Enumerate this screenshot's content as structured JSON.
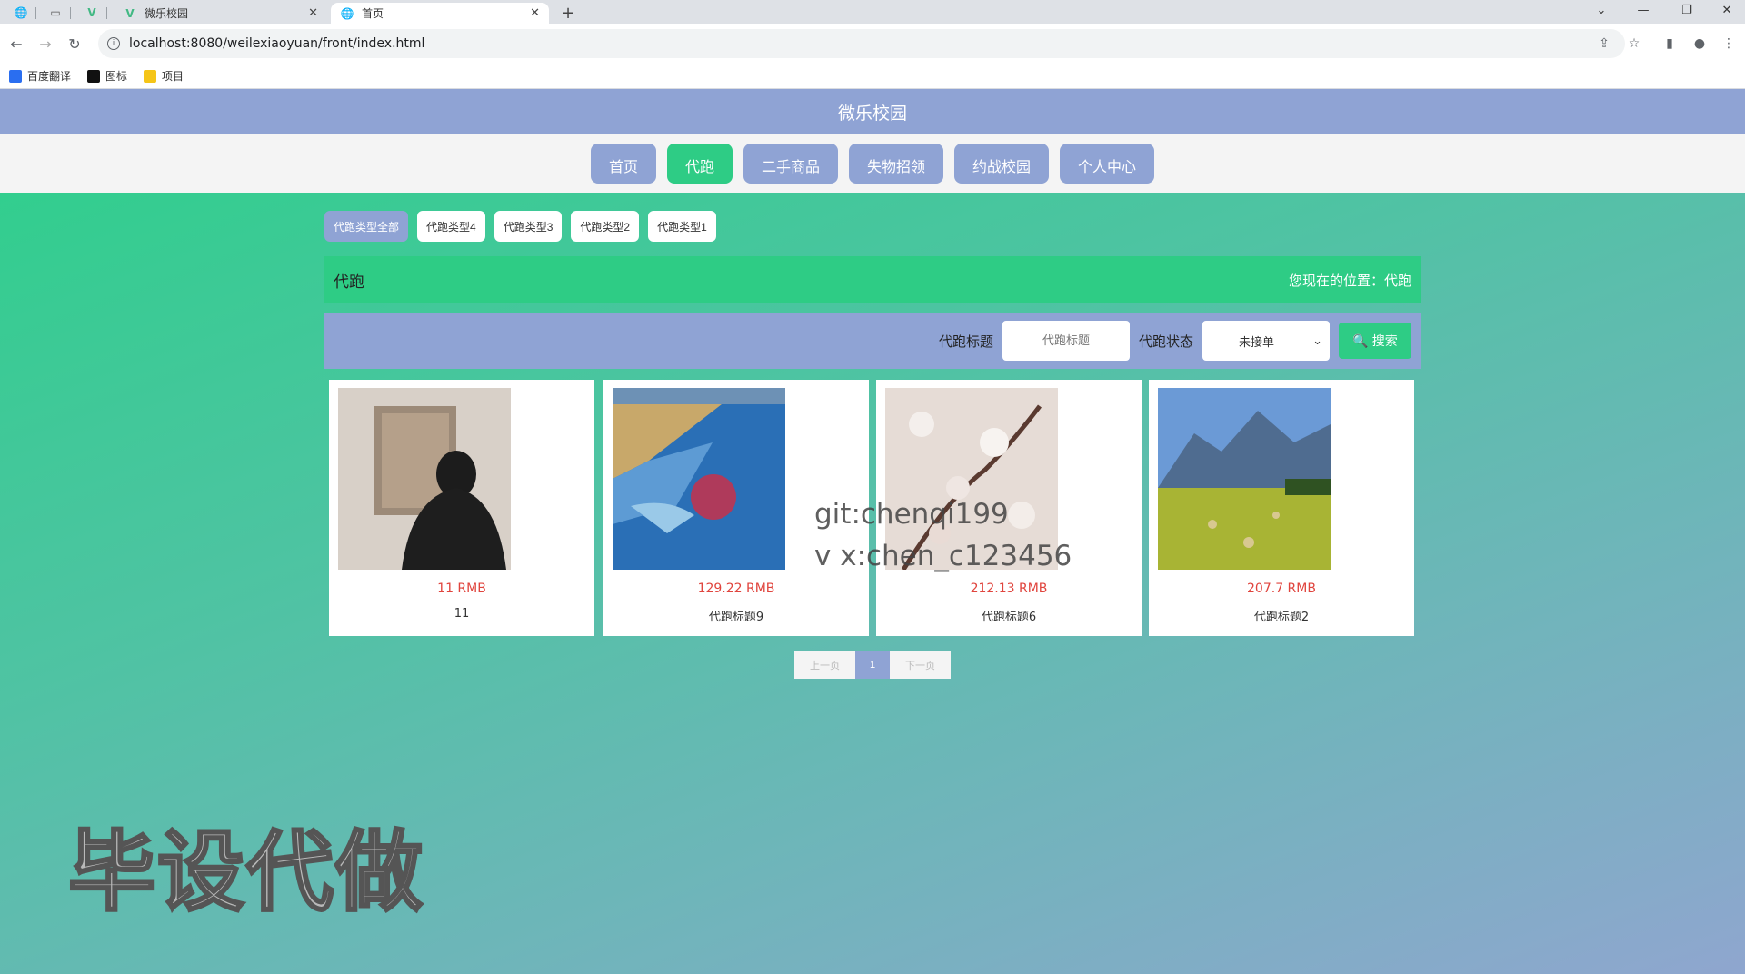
{
  "browser": {
    "tabs": [
      {
        "title": "微乐校园",
        "active": false
      },
      {
        "title": "首页",
        "active": true
      }
    ],
    "url": "localhost:8080/weilexiaoyuan/front/index.html",
    "bookmarks": [
      {
        "label": "百度翻译",
        "icon": "translate-icon",
        "color": "#2a6ef0"
      },
      {
        "label": "图标",
        "icon": "image-icon",
        "color": "#111111"
      },
      {
        "label": "项目",
        "icon": "folder-icon",
        "color": "#f5c518"
      }
    ]
  },
  "site": {
    "title": "微乐校园",
    "nav": [
      "首页",
      "代跑",
      "二手商品",
      "失物招领",
      "约战校园",
      "个人中心"
    ],
    "nav_active_index": 1,
    "colors": {
      "primary": "#8fa3d4",
      "accent": "#2ecc85",
      "price": "#e0443d"
    }
  },
  "filters": {
    "types": [
      "代跑类型全部",
      "代跑类型4",
      "代跑类型3",
      "代跑类型2",
      "代跑类型1"
    ],
    "active_index": 0
  },
  "location": {
    "heading": "代跑",
    "breadcrumb": "您现在的位置：代跑"
  },
  "search": {
    "title_label": "代跑标题",
    "title_placeholder": "代跑标题",
    "status_label": "代跑状态",
    "status_value": "未接单",
    "button_label": "搜索"
  },
  "items": [
    {
      "price": "11 RMB",
      "title": "11",
      "image": "person-at-painting"
    },
    {
      "price": "129.22 RMB",
      "title": "代跑标题9",
      "image": "coastline-aerial"
    },
    {
      "price": "212.13 RMB",
      "title": "代跑标题6",
      "image": "blossom-branch"
    },
    {
      "price": "207.7 RMB",
      "title": "代跑标题2",
      "image": "mountain-meadow"
    }
  ],
  "pagination": {
    "prev": "上一页",
    "current": "1",
    "next": "下一页"
  },
  "overlay": {
    "watermark_line1": "git:chenqi199",
    "watermark_line2": "v x:chen_c123456",
    "ad_text": "毕设代做"
  }
}
